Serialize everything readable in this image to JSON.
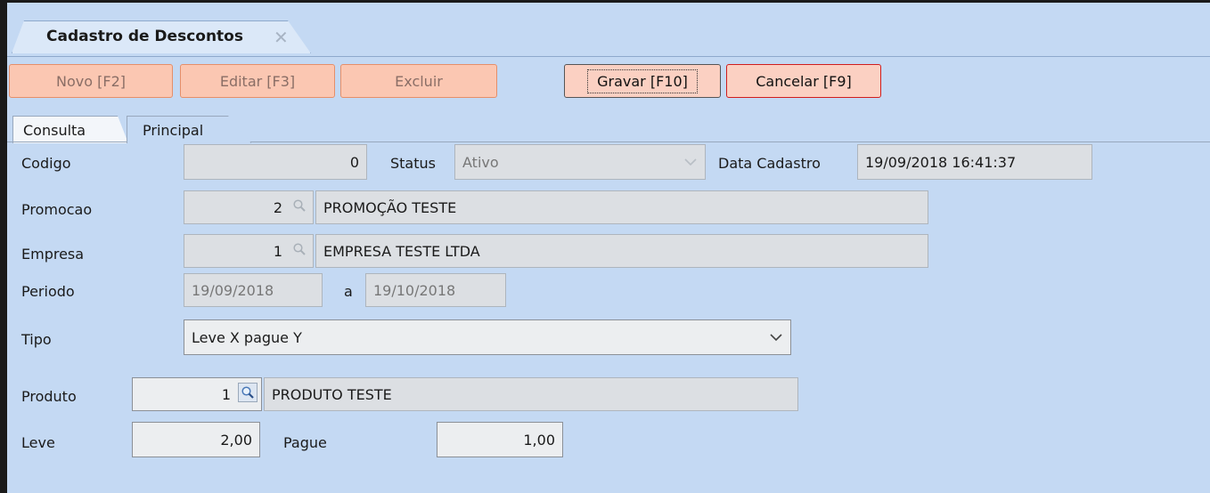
{
  "window": {
    "doc_tab_title": "Cadastro de Descontos"
  },
  "toolbar": {
    "novo_label": "Novo [F2]",
    "editar_label": "Editar [F3]",
    "excluir_label": "Excluir",
    "gravar_label": "Gravar [F10]",
    "cancelar_label": "Cancelar [F9]"
  },
  "tabs": {
    "consulta": "Consulta",
    "principal": "Principal"
  },
  "form": {
    "codigo": {
      "label": "Codigo",
      "value": "0"
    },
    "status": {
      "label": "Status",
      "value": "Ativo"
    },
    "data_cadastro": {
      "label": "Data Cadastro",
      "value": "19/09/2018 16:41:37"
    },
    "promocao": {
      "label": "Promocao",
      "code": "2",
      "description": "PROMOÇÃO TESTE"
    },
    "empresa": {
      "label": "Empresa",
      "code": "1",
      "description": "EMPRESA TESTE LTDA"
    },
    "periodo": {
      "label": "Periodo",
      "start": "19/09/2018",
      "separator": "a",
      "end": "19/10/2018"
    },
    "tipo": {
      "label": "Tipo",
      "value": "Leve X pague Y"
    },
    "produto": {
      "label": "Produto",
      "code": "1",
      "description": "PRODUTO TESTE"
    },
    "leve": {
      "label": "Leve",
      "value": "2,00"
    },
    "pague": {
      "label": "Pague",
      "value": "1,00"
    }
  },
  "icons": {
    "close": "close-icon",
    "lookup": "magnifier-icon",
    "dropdown": "chevron-down-icon"
  }
}
